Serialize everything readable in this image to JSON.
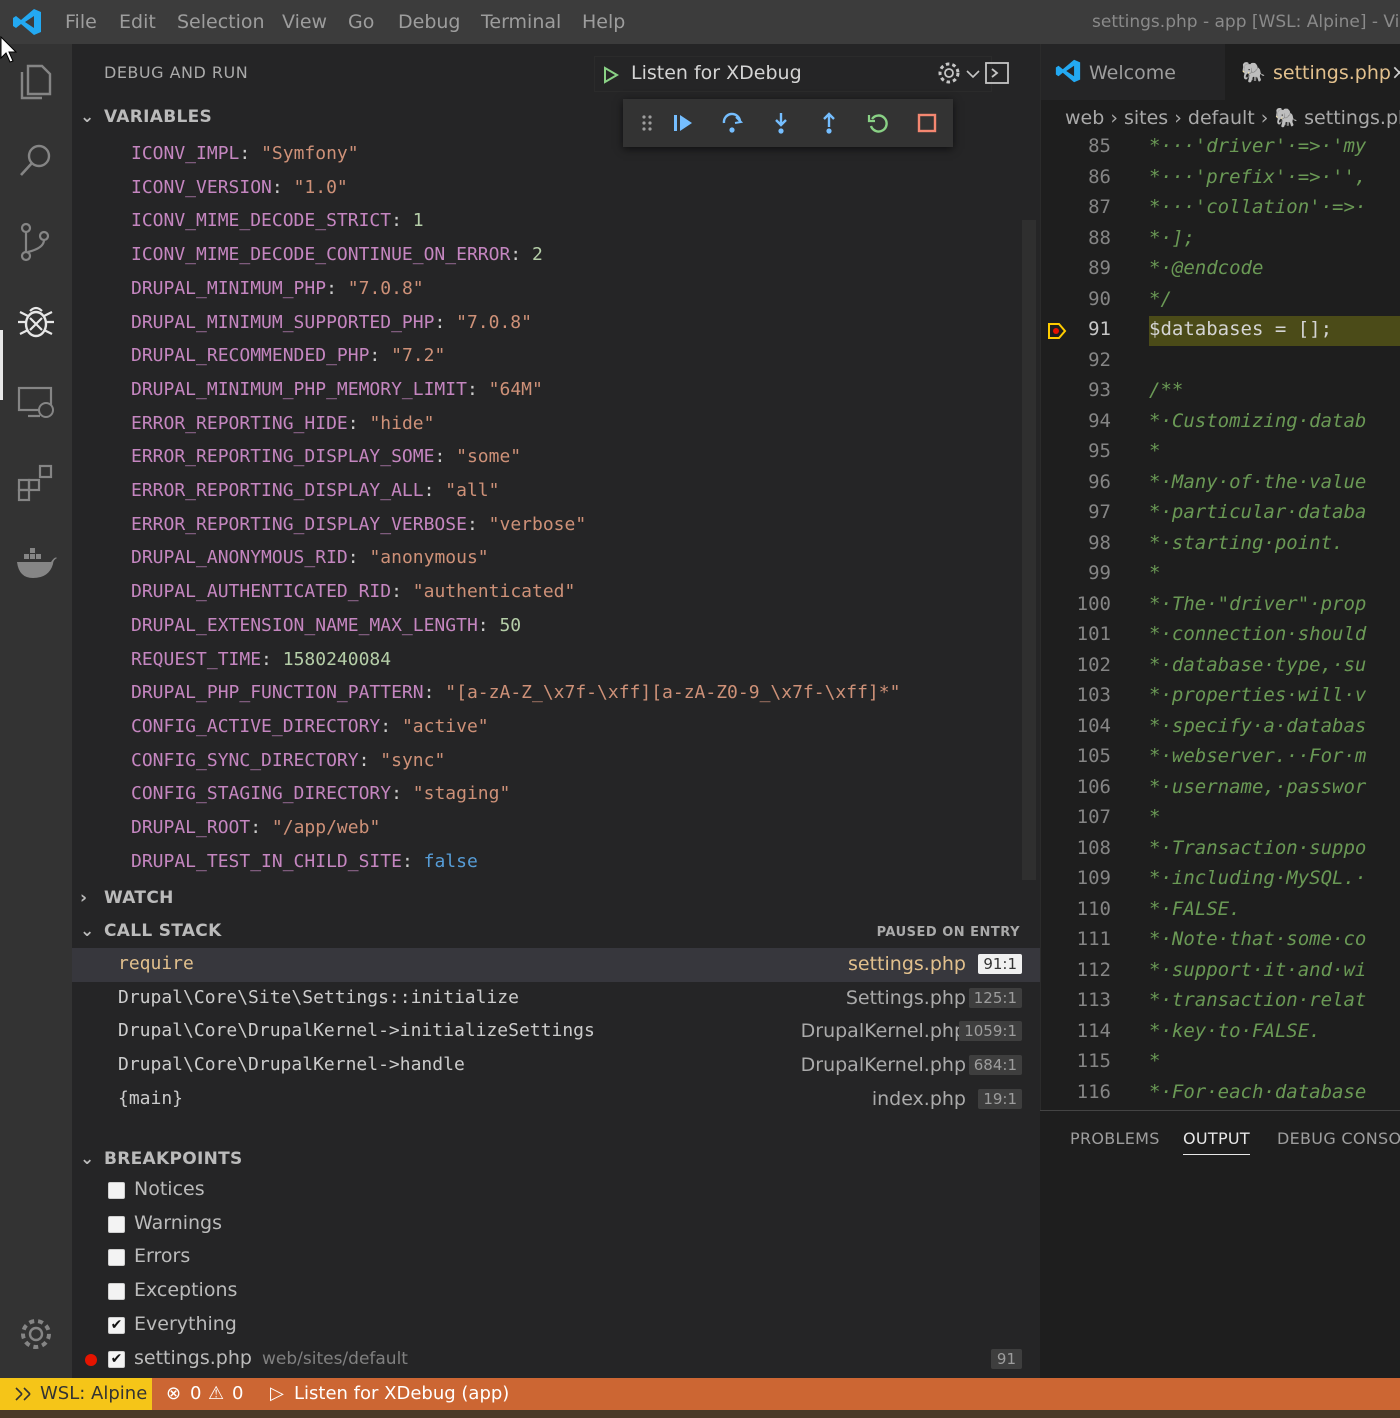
{
  "titlebar": {
    "menu": [
      "File",
      "Edit",
      "Selection",
      "View",
      "Go",
      "Debug",
      "Terminal",
      "Help"
    ],
    "window_title": "settings.php - app [WSL: Alpine] - Visu"
  },
  "sidebar": {
    "title": "DEBUG AND RUN",
    "config": "Listen for XDebug"
  },
  "sections": {
    "variables": "VARIABLES",
    "watch": "WATCH",
    "call_stack": "CALL STACK",
    "breakpoints": "BREAKPOINTS"
  },
  "variables": [
    {
      "name": "ICONV_IMPL",
      "value": "\"Symfony\"",
      "type": "string"
    },
    {
      "name": "ICONV_VERSION",
      "value": "\"1.0\"",
      "type": "string"
    },
    {
      "name": "ICONV_MIME_DECODE_STRICT",
      "value": "1",
      "type": "number"
    },
    {
      "name": "ICONV_MIME_DECODE_CONTINUE_ON_ERROR",
      "value": "2",
      "type": "number"
    },
    {
      "name": "DRUPAL_MINIMUM_PHP",
      "value": "\"7.0.8\"",
      "type": "string"
    },
    {
      "name": "DRUPAL_MINIMUM_SUPPORTED_PHP",
      "value": "\"7.0.8\"",
      "type": "string"
    },
    {
      "name": "DRUPAL_RECOMMENDED_PHP",
      "value": "\"7.2\"",
      "type": "string"
    },
    {
      "name": "DRUPAL_MINIMUM_PHP_MEMORY_LIMIT",
      "value": "\"64M\"",
      "type": "string"
    },
    {
      "name": "ERROR_REPORTING_HIDE",
      "value": "\"hide\"",
      "type": "string"
    },
    {
      "name": "ERROR_REPORTING_DISPLAY_SOME",
      "value": "\"some\"",
      "type": "string"
    },
    {
      "name": "ERROR_REPORTING_DISPLAY_ALL",
      "value": "\"all\"",
      "type": "string"
    },
    {
      "name": "ERROR_REPORTING_DISPLAY_VERBOSE",
      "value": "\"verbose\"",
      "type": "string"
    },
    {
      "name": "DRUPAL_ANONYMOUS_RID",
      "value": "\"anonymous\"",
      "type": "string"
    },
    {
      "name": "DRUPAL_AUTHENTICATED_RID",
      "value": "\"authenticated\"",
      "type": "string"
    },
    {
      "name": "DRUPAL_EXTENSION_NAME_MAX_LENGTH",
      "value": "50",
      "type": "number"
    },
    {
      "name": "REQUEST_TIME",
      "value": "1580240084",
      "type": "number"
    },
    {
      "name": "DRUPAL_PHP_FUNCTION_PATTERN",
      "value": "\"[a-zA-Z_\\x7f-\\xff][a-zA-Z0-9_\\x7f-\\xff]*\"",
      "type": "string"
    },
    {
      "name": "CONFIG_ACTIVE_DIRECTORY",
      "value": "\"active\"",
      "type": "string"
    },
    {
      "name": "CONFIG_SYNC_DIRECTORY",
      "value": "\"sync\"",
      "type": "string"
    },
    {
      "name": "CONFIG_STAGING_DIRECTORY",
      "value": "\"staging\"",
      "type": "string"
    },
    {
      "name": "DRUPAL_ROOT",
      "value": "\"/app/web\"",
      "type": "string"
    },
    {
      "name": "DRUPAL_TEST_IN_CHILD_SITE",
      "value": "false",
      "type": "bool"
    }
  ],
  "call_stack": {
    "status": "PAUSED ON ENTRY",
    "frames": [
      {
        "fn": "require",
        "file": "settings.php",
        "pos": "91:1"
      },
      {
        "fn": "Drupal\\Core\\Site\\Settings::initialize",
        "file": "Settings.php",
        "pos": "125:1"
      },
      {
        "fn": "Drupal\\Core\\DrupalKernel->initializeSettings",
        "file": "DrupalKernel.php",
        "pos": "1059:1"
      },
      {
        "fn": "Drupal\\Core\\DrupalKernel->handle",
        "file": "DrupalKernel.php",
        "pos": "684:1"
      },
      {
        "fn": "{main}",
        "file": "index.php",
        "pos": "19:1"
      }
    ]
  },
  "breakpoints": [
    {
      "label": "Notices",
      "checked": false
    },
    {
      "label": "Warnings",
      "checked": false
    },
    {
      "label": "Errors",
      "checked": false
    },
    {
      "label": "Exceptions",
      "checked": false
    },
    {
      "label": "Everything",
      "checked": true
    },
    {
      "label": "settings.php",
      "path": "web/sites/default",
      "line": "91",
      "checked": true
    }
  ],
  "editor": {
    "tabs": [
      "Welcome",
      "settings.php"
    ],
    "breadcrumb": [
      "web",
      "sites",
      "default",
      "settings.ph"
    ],
    "current_line": "91",
    "lines": [
      {
        "n": "85",
        "text": " *···'driver'·=>·'my"
      },
      {
        "n": "86",
        "text": " *···'prefix'·=>·'',"
      },
      {
        "n": "87",
        "text": " *···'collation'·=>·"
      },
      {
        "n": "88",
        "text": " *·];"
      },
      {
        "n": "89",
        "text": " *·@endcode"
      },
      {
        "n": "90",
        "text": " */"
      },
      {
        "n": "91",
        "text": "$databases = [];"
      },
      {
        "n": "92",
        "text": ""
      },
      {
        "n": "93",
        "text": "/**"
      },
      {
        "n": "94",
        "text": " *·Customizing·datab"
      },
      {
        "n": "95",
        "text": " *"
      },
      {
        "n": "96",
        "text": " *·Many·of·the·value"
      },
      {
        "n": "97",
        "text": " *·particular·databa"
      },
      {
        "n": "98",
        "text": " *·starting·point."
      },
      {
        "n": "99",
        "text": " *"
      },
      {
        "n": "100",
        "text": " *·The·\"driver\"·prop"
      },
      {
        "n": "101",
        "text": " *·connection·should"
      },
      {
        "n": "102",
        "text": " *·database·type,·su"
      },
      {
        "n": "103",
        "text": " *·properties·will·v"
      },
      {
        "n": "104",
        "text": " *·specify·a·databas"
      },
      {
        "n": "105",
        "text": " *·webserver.··For·m"
      },
      {
        "n": "106",
        "text": " *·username,·passwor"
      },
      {
        "n": "107",
        "text": " *"
      },
      {
        "n": "108",
        "text": " *·Transaction·suppo"
      },
      {
        "n": "109",
        "text": " *·including·MySQL.·"
      },
      {
        "n": "110",
        "text": " *·FALSE."
      },
      {
        "n": "111",
        "text": " *·Note·that·some·co"
      },
      {
        "n": "112",
        "text": " *·support·it·and·wi"
      },
      {
        "n": "113",
        "text": " *·transaction·relat"
      },
      {
        "n": "114",
        "text": " *·key·to·FALSE."
      },
      {
        "n": "115",
        "text": " *"
      },
      {
        "n": "116",
        "text": " *·For·each·database"
      }
    ]
  },
  "panel": {
    "tabs": [
      "PROBLEMS",
      "OUTPUT",
      "DEBUG CONSOL"
    ],
    "active": "OUTPUT"
  },
  "statusbar": {
    "remote": "WSL: Alpine",
    "errors": "0",
    "warnings": "0",
    "debug_config": "Listen for XDebug (app)"
  },
  "colors": {
    "accent": "#007acc",
    "string": "#ce9178",
    "number": "#b5cea8",
    "bool": "#569cd6",
    "var_name": "#c586c0",
    "selected_frame": "#e2c08d",
    "status_bar": "#cc6633",
    "remote_badge": "#f5c518",
    "breakpoint": "#e51400"
  }
}
